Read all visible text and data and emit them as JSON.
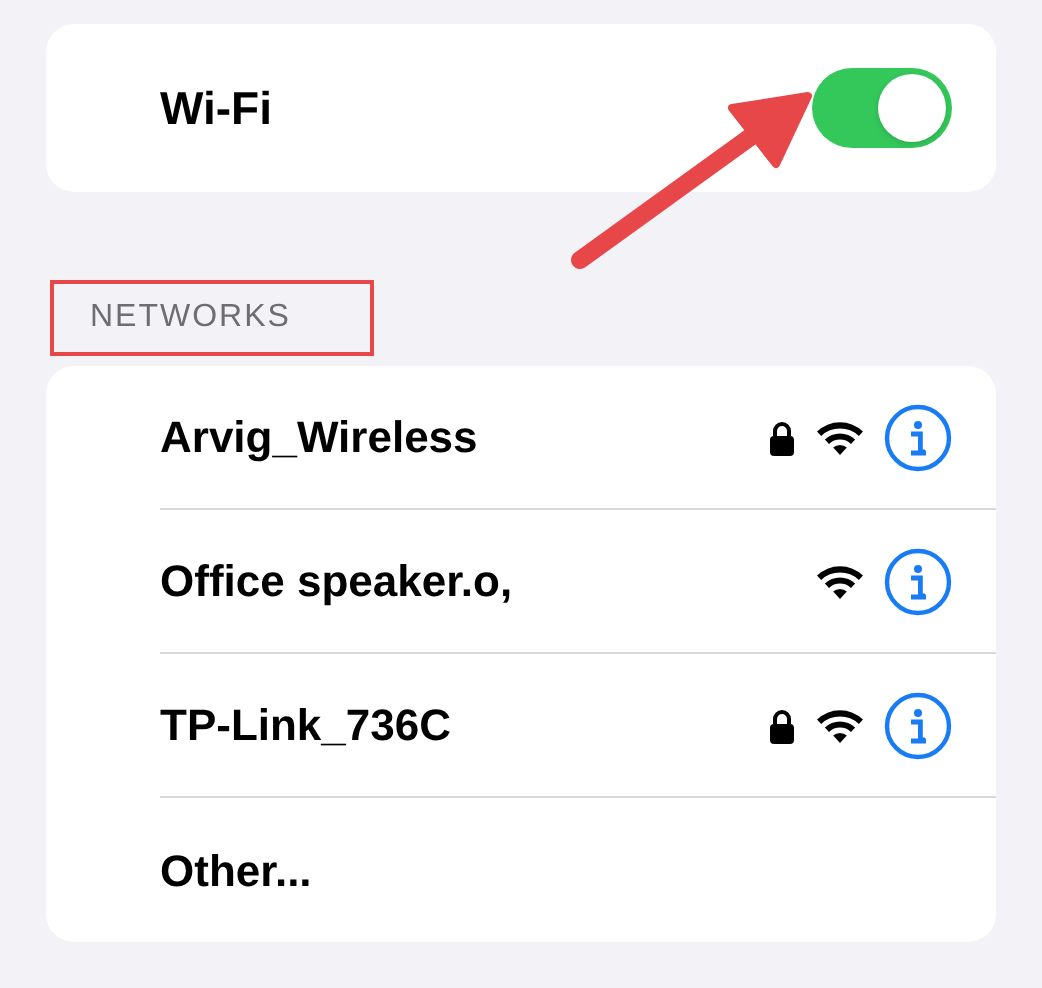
{
  "wifi": {
    "label": "Wi-Fi",
    "on": true
  },
  "networks_header": "NETWORKS",
  "networks": [
    {
      "kind": "network",
      "name": "Arvig_Wireless",
      "locked": true
    },
    {
      "kind": "network",
      "name": "Office speaker.o,",
      "locked": false
    },
    {
      "kind": "network",
      "name": "TP-Link_736C",
      "locked": true
    },
    {
      "kind": "other",
      "name": "Other..."
    }
  ]
}
